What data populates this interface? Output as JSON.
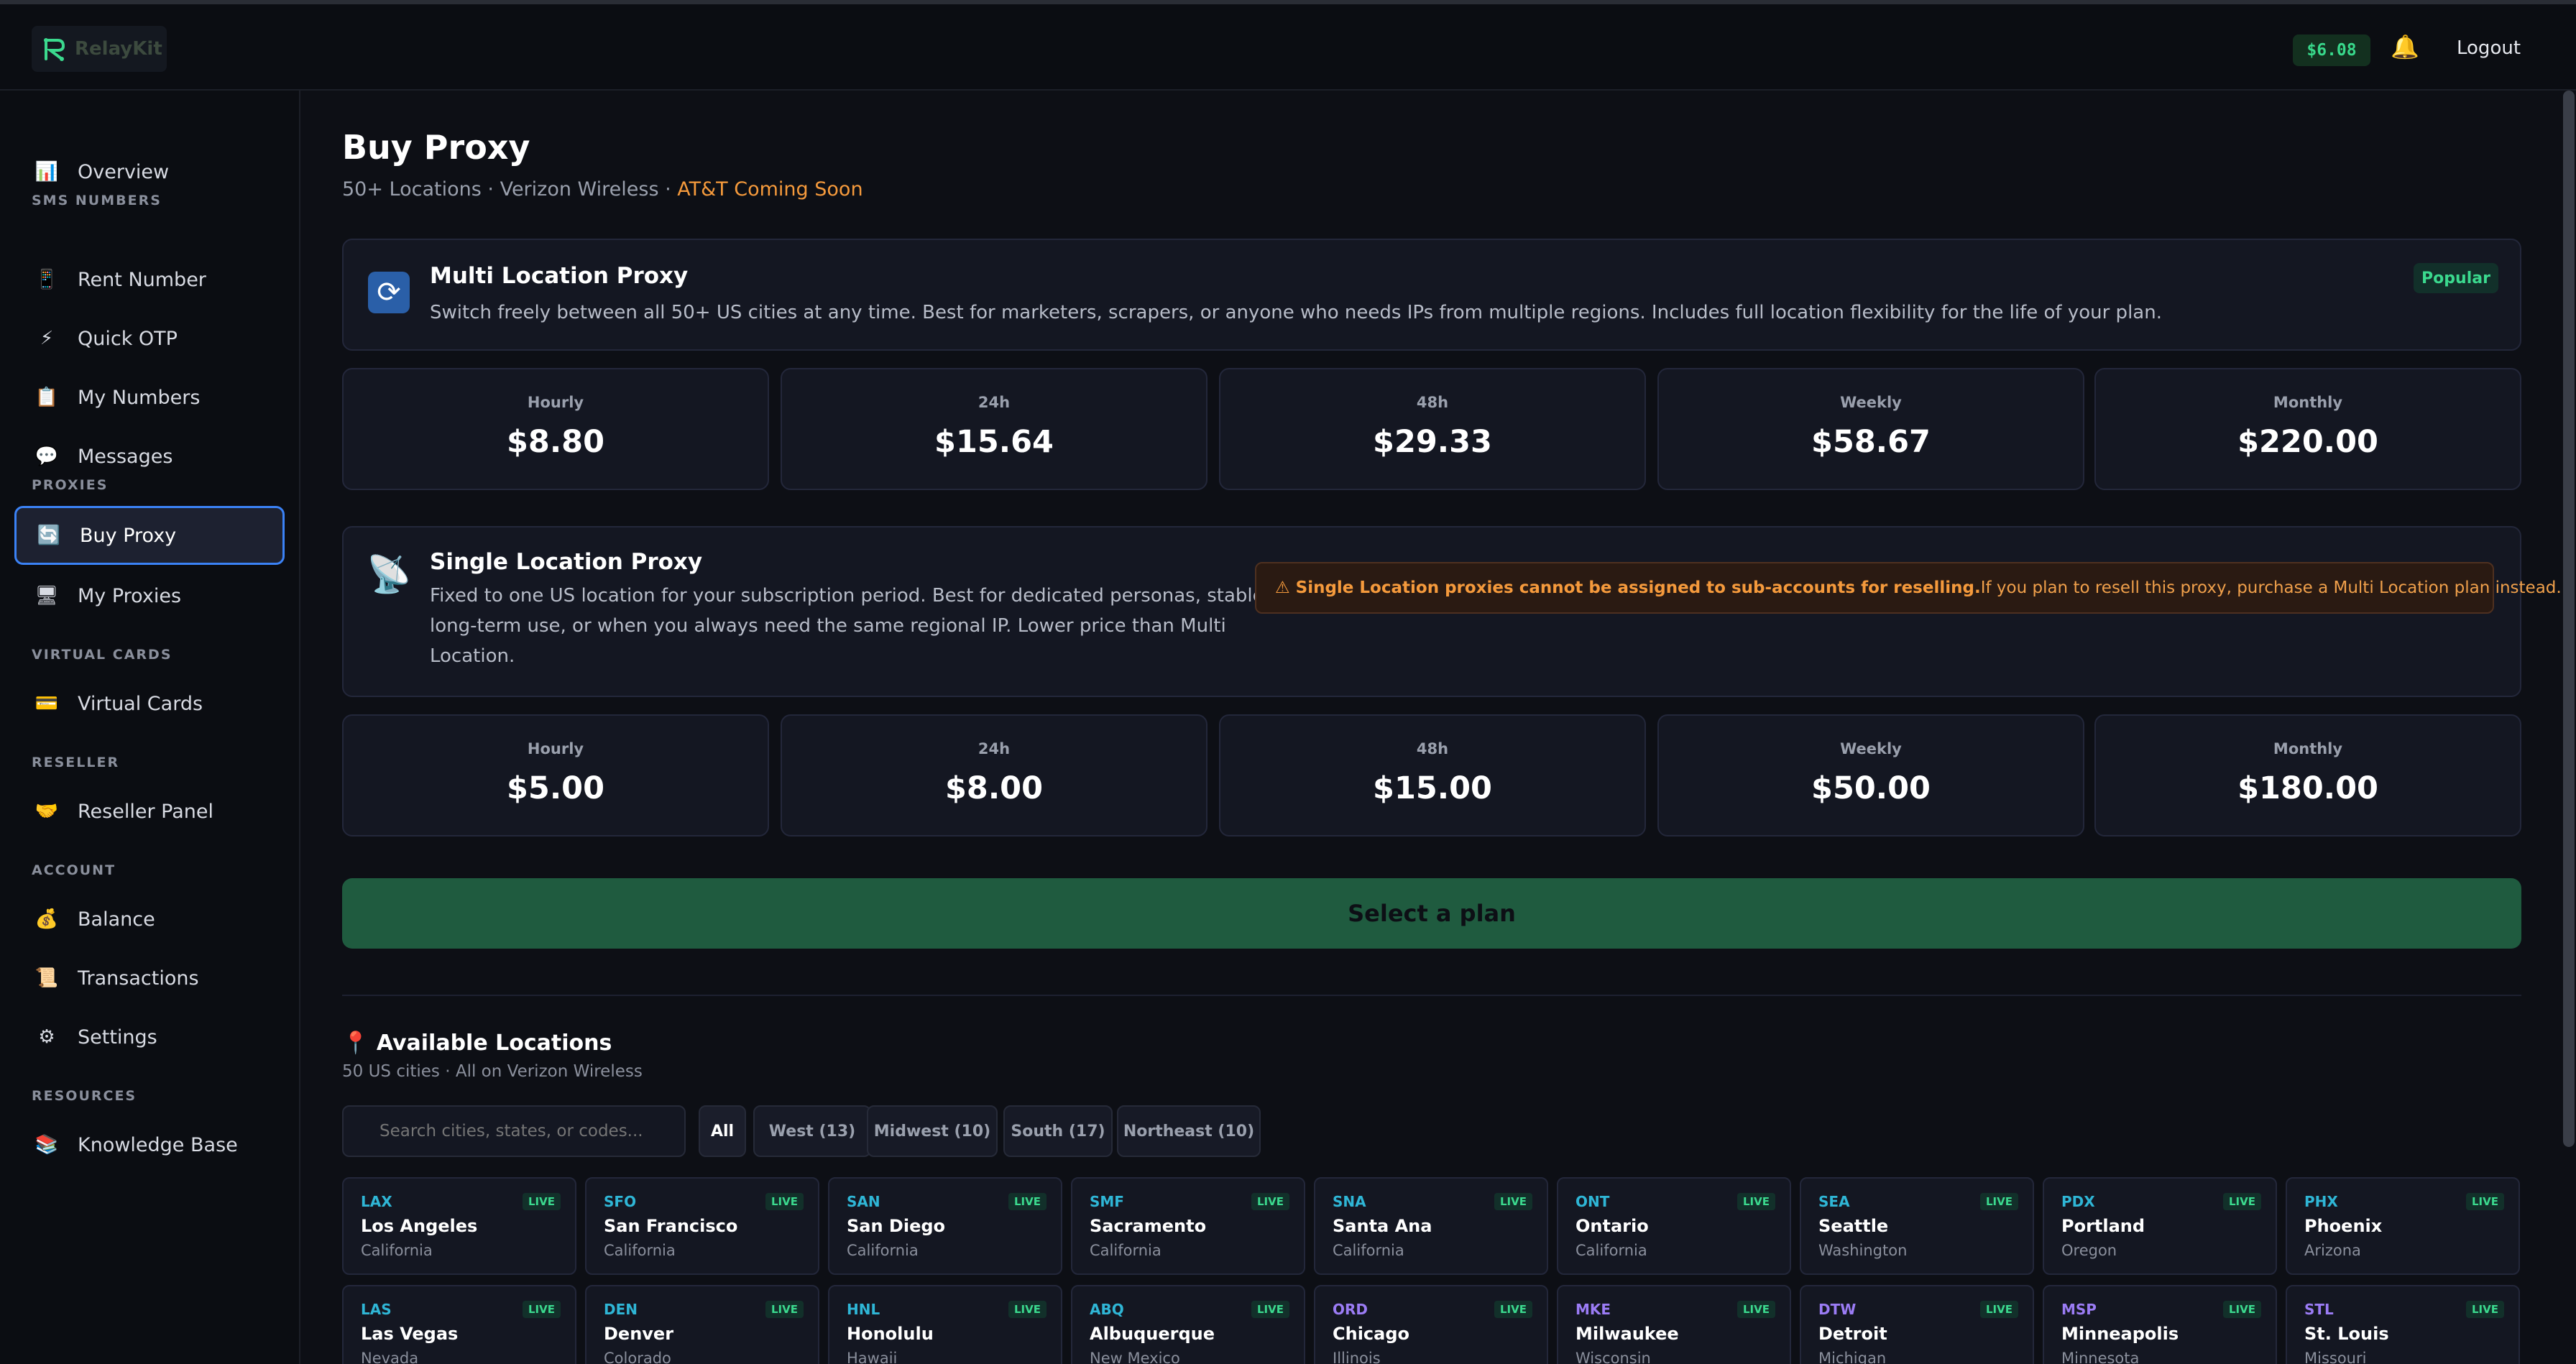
{
  "header": {
    "logo_text": "RelayKit",
    "balance": "$6.08",
    "logout": "Logout"
  },
  "sidebar": {
    "overview": "Overview",
    "sec_sms": "SMS NUMBERS",
    "rent_number": "Rent Number",
    "quick_otp": "Quick OTP",
    "my_numbers": "My Numbers",
    "messages": "Messages",
    "sec_proxies": "PROXIES",
    "buy_proxy": "Buy Proxy",
    "my_proxies": "My Proxies",
    "sec_cards": "VIRTUAL CARDS",
    "virtual_cards": "Virtual Cards",
    "sec_reseller": "RESELLER",
    "reseller_panel": "Reseller Panel",
    "sec_account": "ACCOUNT",
    "balance": "Balance",
    "transactions": "Transactions",
    "settings": "Settings",
    "sec_resources": "RESOURCES",
    "knowledge_base": "Knowledge Base"
  },
  "page": {
    "title": "Buy Proxy",
    "subtitle": "50+ Locations · Verizon Wireless · ",
    "subtitle_highlight": "AT&T Coming Soon"
  },
  "multi": {
    "title": "Multi Location Proxy",
    "desc": "Switch freely between all 50+ US cities at any time. Best for marketers, scrapers, or anyone who needs IPs from multiple regions. Includes full location flexibility for the life of your plan.",
    "badge": "Popular",
    "prices": [
      {
        "label": "Hourly",
        "value": "$8.80"
      },
      {
        "label": "24h",
        "value": "$15.64"
      },
      {
        "label": "48h",
        "value": "$29.33"
      },
      {
        "label": "Weekly",
        "value": "$58.67"
      },
      {
        "label": "Monthly",
        "value": "$220.00"
      }
    ]
  },
  "single": {
    "title": "Single Location Proxy",
    "desc1": "Fixed to one US location for your subscription period. Best for dedicated personas, stable",
    "desc2": "long-term use, or when you always need the same regional IP. Lower price than Multi",
    "desc3": "Location.",
    "warning_bold": "⚠ Single Location proxies cannot be assigned to sub-accounts for reselling.",
    "warning_text": " If you plan to resell this proxy, purchase a Multi Location plan instead.",
    "prices": [
      {
        "label": "Hourly",
        "value": "$5.00"
      },
      {
        "label": "24h",
        "value": "$8.00"
      },
      {
        "label": "48h",
        "value": "$15.00"
      },
      {
        "label": "Weekly",
        "value": "$50.00"
      },
      {
        "label": "Monthly",
        "value": "$180.00"
      }
    ]
  },
  "select_button": "Select a plan",
  "locations": {
    "title": "Available Locations",
    "subtitle": "50 US cities · All on Verizon Wireless",
    "search_placeholder": "Search cities, states, or codes...",
    "filters": [
      "All",
      "West (13)",
      "Midwest (10)",
      "South (17)",
      "Northeast (10)"
    ],
    "live_label": "LIVE",
    "colors": {
      "west": "#2fb6d6",
      "midwest": "#9b7cf5"
    },
    "items": [
      {
        "code": "LAX",
        "city": "Los Angeles",
        "state": "California",
        "region": "west"
      },
      {
        "code": "SFO",
        "city": "San Francisco",
        "state": "California",
        "region": "west"
      },
      {
        "code": "SAN",
        "city": "San Diego",
        "state": "California",
        "region": "west"
      },
      {
        "code": "SMF",
        "city": "Sacramento",
        "state": "California",
        "region": "west"
      },
      {
        "code": "SNA",
        "city": "Santa Ana",
        "state": "California",
        "region": "west"
      },
      {
        "code": "ONT",
        "city": "Ontario",
        "state": "California",
        "region": "west"
      },
      {
        "code": "SEA",
        "city": "Seattle",
        "state": "Washington",
        "region": "west"
      },
      {
        "code": "PDX",
        "city": "Portland",
        "state": "Oregon",
        "region": "west"
      },
      {
        "code": "PHX",
        "city": "Phoenix",
        "state": "Arizona",
        "region": "west"
      },
      {
        "code": "LAS",
        "city": "Las Vegas",
        "state": "Nevada",
        "region": "west"
      },
      {
        "code": "DEN",
        "city": "Denver",
        "state": "Colorado",
        "region": "west"
      },
      {
        "code": "HNL",
        "city": "Honolulu",
        "state": "Hawaii",
        "region": "west"
      },
      {
        "code": "ABQ",
        "city": "Albuquerque",
        "state": "New Mexico",
        "region": "west"
      },
      {
        "code": "ORD",
        "city": "Chicago",
        "state": "Illinois",
        "region": "midwest"
      },
      {
        "code": "MKE",
        "city": "Milwaukee",
        "state": "Wisconsin",
        "region": "midwest"
      },
      {
        "code": "DTW",
        "city": "Detroit",
        "state": "Michigan",
        "region": "midwest"
      },
      {
        "code": "MSP",
        "city": "Minneapolis",
        "state": "Minnesota",
        "region": "midwest"
      },
      {
        "code": "STL",
        "city": "St. Louis",
        "state": "Missouri",
        "region": "midwest"
      }
    ]
  }
}
